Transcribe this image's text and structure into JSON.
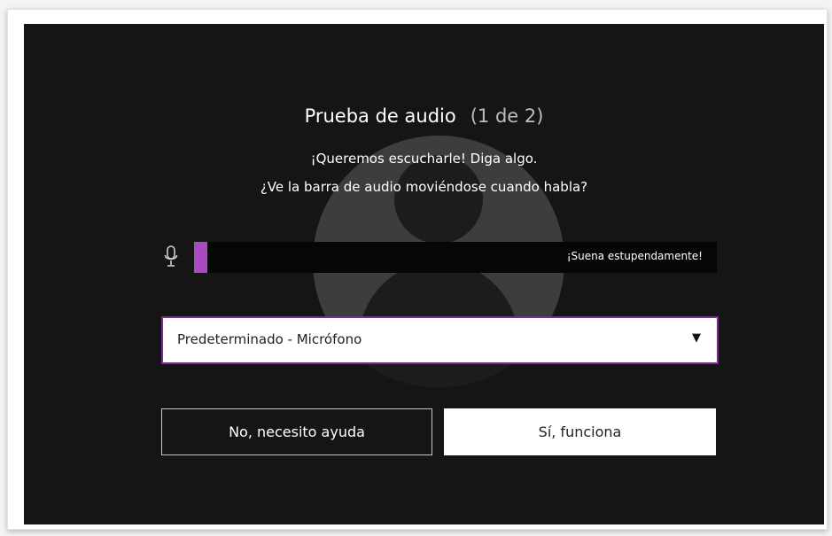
{
  "dialog": {
    "title": "Prueba de audio",
    "step": "(1 de 2)",
    "line1": "¡Queremos escucharle! Diga algo.",
    "line2": "¿Ve la barra de audio moviéndose cuando habla?"
  },
  "meter": {
    "level": 0.025,
    "status": "¡Suena estupendamente!",
    "fill_color": "#a84bc0"
  },
  "microphone_select": {
    "selected": "Predeterminado - Micrófono"
  },
  "buttons": {
    "no_label": "No, necesito ayuda",
    "yes_label": "Sí, funciona"
  },
  "icons": {
    "mic": "microphone-icon",
    "dropdown": "caret-down-icon",
    "background": "user-silhouette-icon"
  },
  "colors": {
    "dialog_bg": "#151515",
    "accent": "#7b2a8e"
  }
}
